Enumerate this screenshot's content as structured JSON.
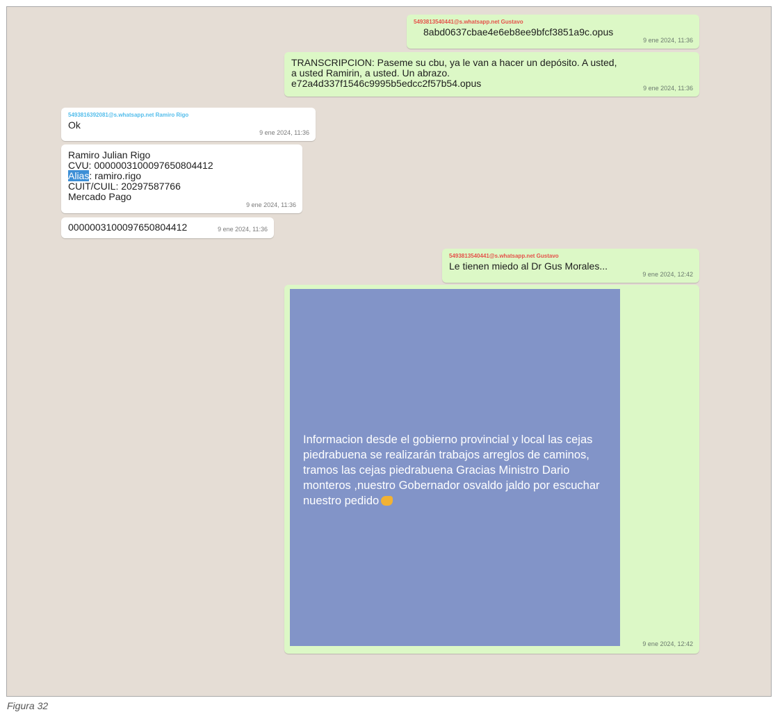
{
  "messages": [
    {
      "sender": "5493813540441@s.whatsapp.net Gustavo",
      "text": "8abd0637cbae4e6eb8ee9bfcf3851a9c.opus",
      "time": "9 ene 2024, 11:36"
    },
    {
      "text": "TRANSCRIPCION: Paseme su cbu, ya le van a hacer un depósito. A usted, a usted Ramirin, a usted. Un abrazo.\ne72a4d337f1546c9995b5edcc2f57b54.opus",
      "time": "9 ene 2024, 11:36"
    },
    {
      "sender": "5493816392081@s.whatsapp.net Ramiro Rigo",
      "text": "Ok",
      "time": "9 ene 2024, 11:36"
    },
    {
      "lines": [
        "Ramiro Julian Rigo",
        "CVU: 0000003100097650804412"
      ],
      "alias_label": "Alias",
      "alias_value": ": ramiro.rigo",
      "lines2": [
        "CUIT/CUIL: 20297587766",
        "Mercado Pago"
      ],
      "time": "9 ene 2024, 11:36"
    },
    {
      "text": "0000003100097650804412",
      "time": "9 ene 2024, 11:36"
    },
    {
      "sender": "5493813540441@s.whatsapp.net Gustavo",
      "text": "Le tienen miedo al Dr Gus Morales...",
      "time": "9 ene 2024, 12:42"
    },
    {
      "image_text": "Informacion desde el gobierno provincial y local las cejas piedrabuena se realizarán trabajos arreglos de caminos, tramos las cejas piedrabuena Gracias Ministro Dario monteros ,nuestro Gobernador osvaldo jaldo por escuchar nuestro pedido",
      "emoji": "flexed-biceps-emoji",
      "time": "9 ene 2024, 12:42"
    }
  ],
  "caption": "Figura 32",
  "colors": {
    "outgoing": "#dcf8c6",
    "incoming": "#ffffff",
    "background": "#e5ddd5",
    "image": "#8294c8"
  }
}
